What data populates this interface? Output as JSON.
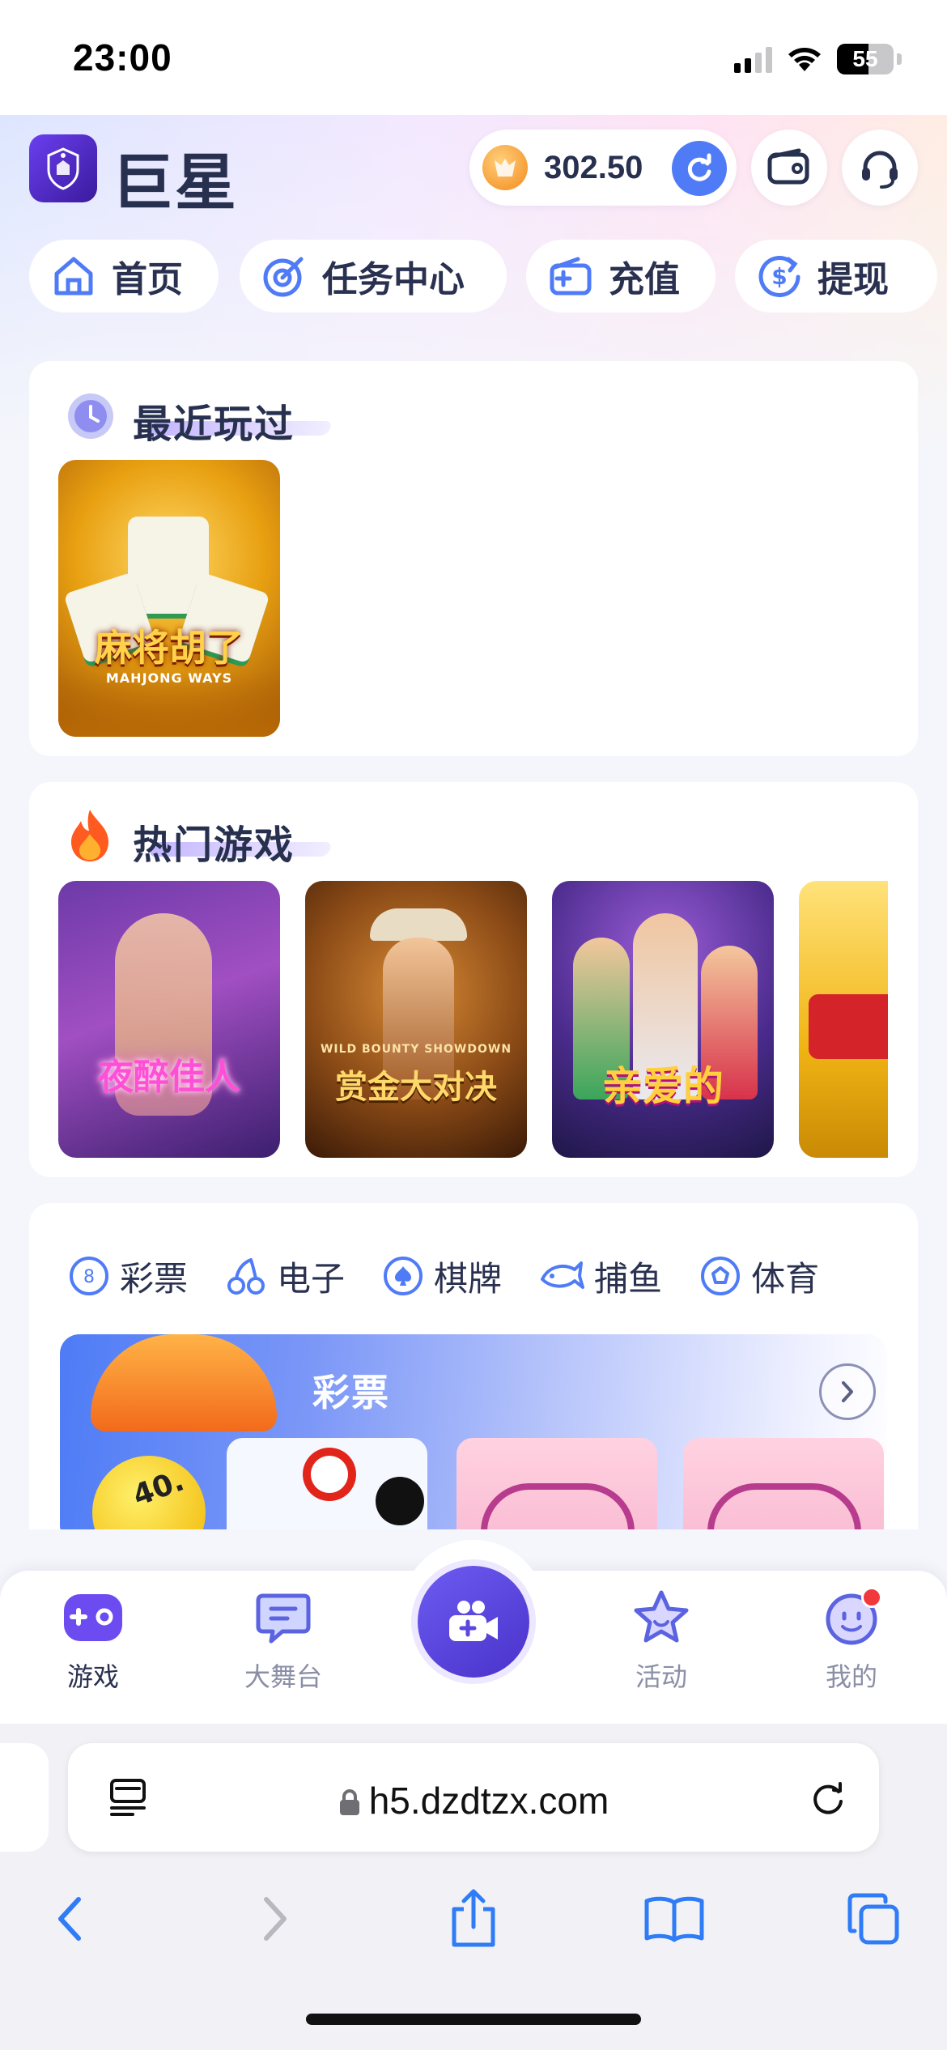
{
  "status_bar": {
    "time": "23:00",
    "battery": "55"
  },
  "header": {
    "logo_text": "巨星",
    "balance": "302.50"
  },
  "quick_nav": [
    {
      "label": "首页",
      "icon": "home-icon"
    },
    {
      "label": "任务中心",
      "icon": "target-icon"
    },
    {
      "label": "充值",
      "icon": "wallet-plus-icon"
    },
    {
      "label": "提现",
      "icon": "dollar-arrow-icon"
    }
  ],
  "recent": {
    "title": "最近玩过",
    "games": [
      {
        "name": "麻将胡了",
        "subtitle": "MAHJONG WAYS"
      }
    ]
  },
  "hot": {
    "title": "热门游戏",
    "games": [
      {
        "name": "夜醉佳人"
      },
      {
        "name": "赏金大对决",
        "subtitle": "WILD BOUNTY SHOWDOWN"
      },
      {
        "name": "亲爱的"
      },
      {
        "name": ""
      }
    ]
  },
  "categories": {
    "tabs": [
      {
        "label": "彩票",
        "icon": "lottery-ball-icon"
      },
      {
        "label": "电子",
        "icon": "cherry-icon"
      },
      {
        "label": "棋牌",
        "icon": "spade-chip-icon"
      },
      {
        "label": "捕鱼",
        "icon": "fish-icon"
      },
      {
        "label": "体育",
        "icon": "soccer-ball-icon"
      }
    ],
    "banner_title": "彩票",
    "ball_number": "40."
  },
  "tabbar": [
    {
      "label": "游戏",
      "icon": "gamepad-icon",
      "active": true
    },
    {
      "label": "大舞台",
      "icon": "chat-bubble-icon",
      "active": false
    },
    {
      "label": "",
      "icon": "video-camera-icon",
      "active": false
    },
    {
      "label": "活动",
      "icon": "star-icon",
      "active": false
    },
    {
      "label": "我的",
      "icon": "smiley-icon",
      "active": false
    }
  ],
  "browser": {
    "url": "h5.dzdtzx.com"
  },
  "colors": {
    "accent": "#5b47e0",
    "primary_text": "#27304f",
    "blue": "#4f7bf7"
  }
}
